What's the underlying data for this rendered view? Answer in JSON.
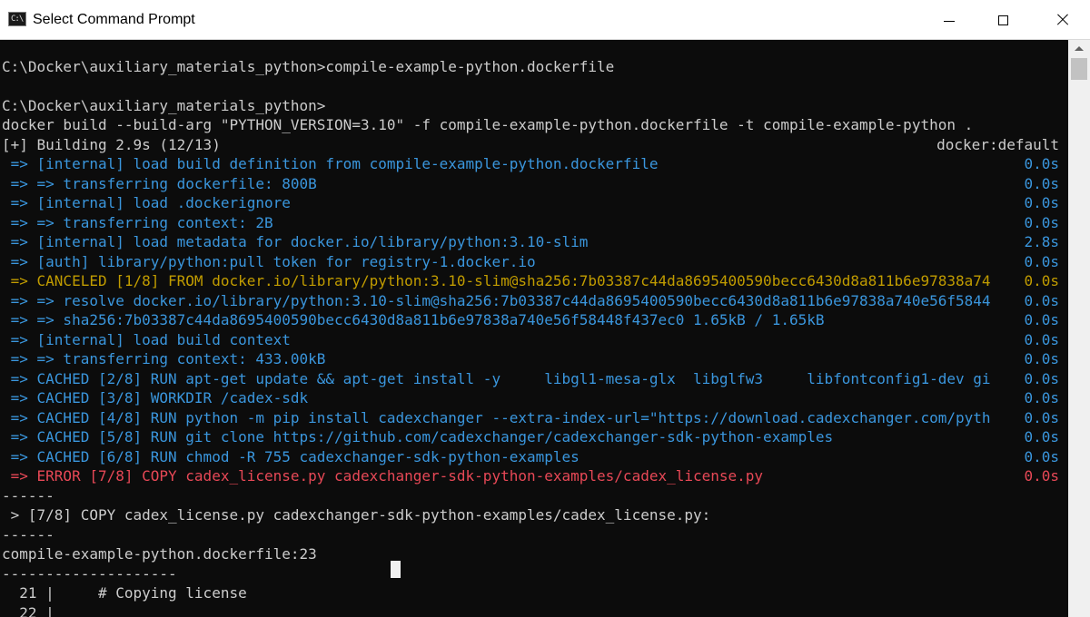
{
  "window": {
    "title": "Select Command Prompt",
    "icon": "cmd-icon",
    "icon_text": "C:\\",
    "minimize_icon": "minimize-icon",
    "maximize_icon": "maximize-icon",
    "close_icon": "close-icon"
  },
  "colors": {
    "background": "#0c0c0c",
    "text": "#cccccc",
    "blue": "#3a96dd",
    "yellow": "#c19c00",
    "red": "#e74856"
  },
  "terminal": {
    "lines": [
      {
        "text": "",
        "right": ""
      },
      {
        "text": "C:\\Docker\\auxiliary_materials_python>compile-example-python.dockerfile",
        "right": ""
      },
      {
        "text": "",
        "right": ""
      },
      {
        "text": "C:\\Docker\\auxiliary_materials_python>",
        "right": ""
      },
      {
        "text": "docker build --build-arg \"PYTHON_VERSION=3.10\" -f compile-example-python.dockerfile -t compile-example-python .",
        "right": ""
      },
      {
        "text": "[+] Building 2.9s (12/13)",
        "right": "docker:default"
      },
      {
        "text": " => [internal] load build definition from compile-example-python.dockerfile",
        "right": "0.0s"
      },
      {
        "text": " => => transferring dockerfile: 800B",
        "right": "0.0s"
      },
      {
        "text": " => [internal] load .dockerignore",
        "right": "0.0s"
      },
      {
        "text": " => => transferring context: 2B",
        "right": "0.0s"
      },
      {
        "text": " => [internal] load metadata for docker.io/library/python:3.10-slim",
        "right": "2.8s"
      },
      {
        "text": " => [auth] library/python:pull token for registry-1.docker.io",
        "right": "0.0s"
      },
      {
        "text": " => CANCELED [1/8] FROM docker.io/library/python:3.10-slim@sha256:7b03387c44da8695400590becc6430d8a811b6e97838a74",
        "right": "0.0s"
      },
      {
        "text": " => => resolve docker.io/library/python:3.10-slim@sha256:7b03387c44da8695400590becc6430d8a811b6e97838a740e56f5844",
        "right": "0.0s"
      },
      {
        "text": " => => sha256:7b03387c44da8695400590becc6430d8a811b6e97838a740e56f58448f437ec0 1.65kB / 1.65kB",
        "right": "0.0s"
      },
      {
        "text": " => [internal] load build context",
        "right": "0.0s"
      },
      {
        "text": " => => transferring context: 433.00kB",
        "right": "0.0s"
      },
      {
        "text": " => CACHED [2/8] RUN apt-get update && apt-get install -y     libgl1-mesa-glx  libglfw3     libfontconfig1-dev gi",
        "right": "0.0s"
      },
      {
        "text": " => CACHED [3/8] WORKDIR /cadex-sdk",
        "right": "0.0s"
      },
      {
        "text": " => CACHED [4/8] RUN python -m pip install cadexchanger --extra-index-url=\"https://download.cadexchanger.com/pyth",
        "right": "0.0s"
      },
      {
        "text": " => CACHED [5/8] RUN git clone https://github.com/cadexchanger/cadexchanger-sdk-python-examples",
        "right": "0.0s"
      },
      {
        "text": " => CACHED [6/8] RUN chmod -R 755 cadexchanger-sdk-python-examples",
        "right": "0.0s"
      },
      {
        "text": " => ERROR [7/8] COPY cadex_license.py cadexchanger-sdk-python-examples/cadex_license.py",
        "right": "0.0s"
      },
      {
        "text": "------",
        "right": ""
      },
      {
        "text": " > [7/8] COPY cadex_license.py cadexchanger-sdk-python-examples/cadex_license.py:",
        "right": ""
      },
      {
        "text": "------",
        "right": ""
      },
      {
        "text": "compile-example-python.dockerfile:23",
        "right": ""
      },
      {
        "text": "--------------------",
        "right": ""
      },
      {
        "text": "  21 |     # Copying license",
        "right": ""
      },
      {
        "text": "  22 |",
        "right": ""
      }
    ]
  }
}
